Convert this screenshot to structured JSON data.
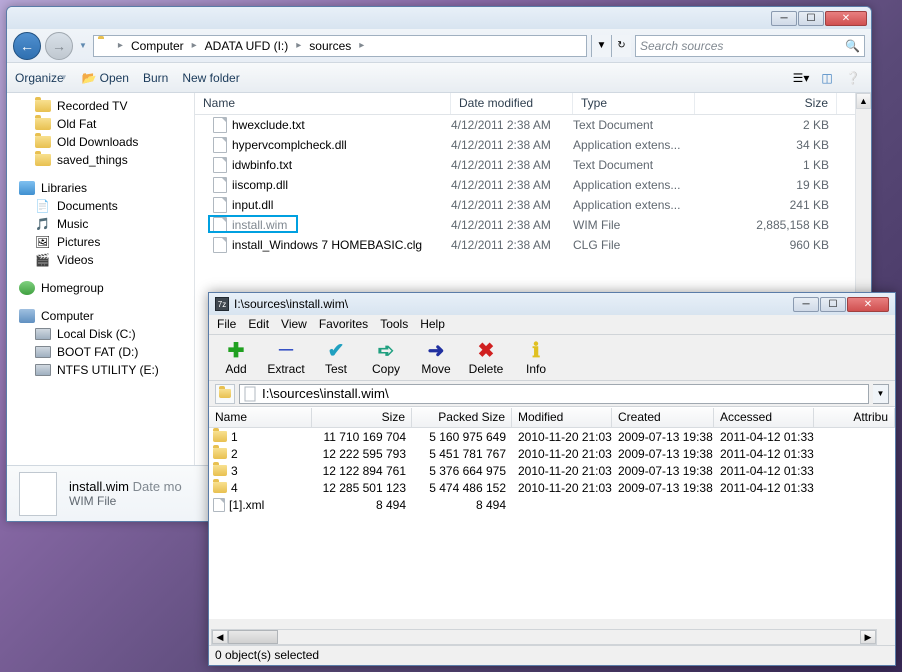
{
  "explorer": {
    "titlebar": {
      "minimize": "─",
      "maximize": "☐",
      "close": "✕"
    },
    "nav": {
      "back": "←",
      "forward": "→",
      "dropdown": "▼"
    },
    "breadcrumbs": [
      "Computer",
      "ADATA UFD (I:)",
      "sources"
    ],
    "address_dropdown": "▼",
    "address_refresh": "↻",
    "search_placeholder": "Search sources",
    "toolbar": {
      "organize": "Organize",
      "open": "Open",
      "burn": "Burn",
      "new_folder": "New folder",
      "view_dd": "▾"
    },
    "sidebar": {
      "items_top": [
        {
          "label": "Recorded TV",
          "icon": "folder"
        },
        {
          "label": "Old Fat",
          "icon": "folder"
        },
        {
          "label": "Old Downloads",
          "icon": "folder"
        },
        {
          "label": "saved_things",
          "icon": "folder"
        }
      ],
      "libraries": {
        "label": "Libraries",
        "items": [
          "Documents",
          "Music",
          "Pictures",
          "Videos"
        ]
      },
      "homegroup": {
        "label": "Homegroup"
      },
      "computer": {
        "label": "Computer",
        "items": [
          "Local Disk (C:)",
          "BOOT FAT (D:)",
          "NTFS UTILITY (E:)"
        ]
      }
    },
    "columns": {
      "name": "Name",
      "date": "Date modified",
      "type": "Type",
      "size": "Size"
    },
    "files": [
      {
        "name": "hwexclude.txt",
        "date": "4/12/2011 2:38 AM",
        "type": "Text Document",
        "size": "2 KB",
        "cut": false
      },
      {
        "name": "hypervcomplcheck.dll",
        "date": "4/12/2011 2:38 AM",
        "type": "Application extens...",
        "size": "34 KB",
        "cut": false
      },
      {
        "name": "idwbinfo.txt",
        "date": "4/12/2011 2:38 AM",
        "type": "Text Document",
        "size": "1 KB",
        "cut": false
      },
      {
        "name": "iiscomp.dll",
        "date": "4/12/2011 2:38 AM",
        "type": "Application extens...",
        "size": "19 KB",
        "cut": false
      },
      {
        "name": "input.dll",
        "date": "4/12/2011 2:38 AM",
        "type": "Application extens...",
        "size": "241 KB",
        "cut": false
      },
      {
        "name": "install.wim",
        "date": "4/12/2011 2:38 AM",
        "type": "WIM File",
        "size": "2,885,158 KB",
        "cut": true
      },
      {
        "name": "install_Windows 7 HOMEBASIC.clg",
        "date": "4/12/2011 2:38 AM",
        "type": "CLG File",
        "size": "960 KB",
        "cut": false
      }
    ],
    "truncated_row": {
      "name": "...",
      "date": "",
      "type": "",
      "size": ""
    },
    "details": {
      "name": "install.wim",
      "sub": "WIM File",
      "date_label": "Date mo"
    }
  },
  "sevenzip": {
    "title": "I:\\sources\\install.wim\\",
    "menu": [
      "File",
      "Edit",
      "View",
      "Favorites",
      "Tools",
      "Help"
    ],
    "tools": [
      {
        "label": "Add",
        "glyph": "✚",
        "color": "#20a020"
      },
      {
        "label": "Extract",
        "glyph": "─",
        "color": "#2040c0"
      },
      {
        "label": "Test",
        "glyph": "✔",
        "color": "#20a0c0"
      },
      {
        "label": "Copy",
        "glyph": "➪",
        "color": "#20a080"
      },
      {
        "label": "Move",
        "glyph": "➜",
        "color": "#2030a0"
      },
      {
        "label": "Delete",
        "glyph": "✖",
        "color": "#d02020"
      },
      {
        "label": "Info",
        "glyph": "ℹ",
        "color": "#e0c020"
      }
    ],
    "path": "I:\\sources\\install.wim\\",
    "columns": {
      "name": "Name",
      "size": "Size",
      "packed": "Packed Size",
      "modified": "Modified",
      "created": "Created",
      "accessed": "Accessed",
      "attr": "Attribu"
    },
    "rows": [
      {
        "name": "1",
        "icon": "folder",
        "size": "11 710 169 704",
        "packed": "5 160 975 649",
        "modified": "2010-11-20 21:03",
        "created": "2009-07-13 19:38",
        "accessed": "2011-04-12 01:33"
      },
      {
        "name": "2",
        "icon": "folder",
        "size": "12 222 595 793",
        "packed": "5 451 781 767",
        "modified": "2010-11-20 21:03",
        "created": "2009-07-13 19:38",
        "accessed": "2011-04-12 01:33"
      },
      {
        "name": "3",
        "icon": "folder",
        "size": "12 122 894 761",
        "packed": "5 376 664 975",
        "modified": "2010-11-20 21:03",
        "created": "2009-07-13 19:38",
        "accessed": "2011-04-12 01:33"
      },
      {
        "name": "4",
        "icon": "folder",
        "size": "12 285 501 123",
        "packed": "5 474 486 152",
        "modified": "2010-11-20 21:03",
        "created": "2009-07-13 19:38",
        "accessed": "2011-04-12 01:33"
      },
      {
        "name": "[1].xml",
        "icon": "file",
        "size": "8 494",
        "packed": "8 494",
        "modified": "",
        "created": "",
        "accessed": ""
      }
    ],
    "status": "0 object(s) selected"
  }
}
